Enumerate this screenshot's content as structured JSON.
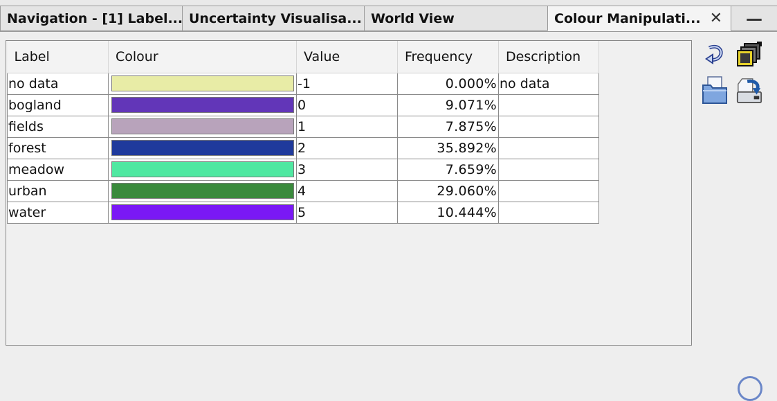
{
  "tabs": [
    {
      "label": "Navigation - [1] Label...",
      "active": false
    },
    {
      "label": "Uncertainty Visualisa...",
      "active": false
    },
    {
      "label": "World View",
      "active": false
    },
    {
      "label": "Colour Manipulati...",
      "active": true,
      "close": "✕"
    }
  ],
  "minimize_label": "—",
  "table": {
    "headers": {
      "label": "Label",
      "colour": "Colour",
      "value": "Value",
      "frequency": "Frequency",
      "description": "Description"
    },
    "rows": [
      {
        "label": "no data",
        "colour": "#e8eca6",
        "value": "-1",
        "frequency": "0.000%",
        "description": "no data"
      },
      {
        "label": "bogland",
        "colour": "#6236b8",
        "value": "0",
        "frequency": "9.071%",
        "description": ""
      },
      {
        "label": "fields",
        "colour": "#b8a3bb",
        "value": "1",
        "frequency": "7.875%",
        "description": ""
      },
      {
        "label": "forest",
        "colour": "#1f3a9c",
        "value": "2",
        "frequency": "35.892%",
        "description": ""
      },
      {
        "label": "meadow",
        "colour": "#4fe8a1",
        "value": "3",
        "frequency": "7.659%",
        "description": ""
      },
      {
        "label": "urban",
        "colour": "#3a8a3c",
        "value": "4",
        "frequency": "29.060%",
        "description": ""
      },
      {
        "label": "water",
        "colour": "#7a18f5",
        "value": "5",
        "frequency": "10.444%",
        "description": ""
      }
    ]
  },
  "side_icons": [
    "refresh-icon",
    "layers-icon",
    "open-file-icon",
    "save-file-icon"
  ]
}
